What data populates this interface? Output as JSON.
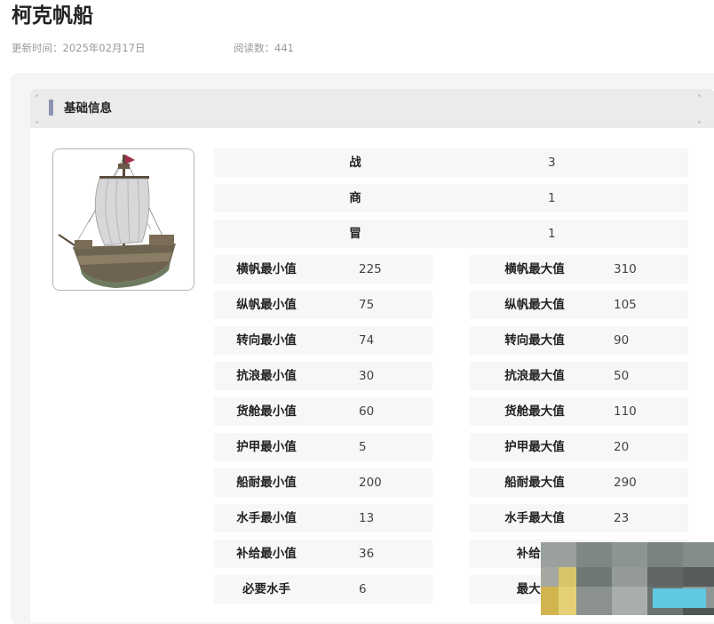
{
  "page": {
    "title": "柯克帆船",
    "update_time": "更新时间：2025年02月17日",
    "read_count": "阅读数：441"
  },
  "section": {
    "header": "基础信息"
  },
  "ship_image": {
    "icon": "sailing-ship-image"
  },
  "full_rows": [
    {
      "label": "战",
      "value": "3"
    },
    {
      "label": "商",
      "value": "1"
    },
    {
      "label": "冒",
      "value": "1"
    }
  ],
  "stat_rows": [
    {
      "left_label": "横帆最小值",
      "left_value": "225",
      "right_label": "横帆最大值",
      "right_value": "310"
    },
    {
      "left_label": "纵帆最小值",
      "left_value": "75",
      "right_label": "纵帆最大值",
      "right_value": "105"
    },
    {
      "left_label": "转向最小值",
      "left_value": "74",
      "right_label": "转向最大值",
      "right_value": "90"
    },
    {
      "left_label": "抗浪最小值",
      "left_value": "30",
      "right_label": "抗浪最大值",
      "right_value": "50"
    },
    {
      "left_label": "货舱最小值",
      "left_value": "60",
      "right_label": "货舱最大值",
      "right_value": "110"
    },
    {
      "left_label": "护甲最小值",
      "left_value": "5",
      "right_label": "护甲最大值",
      "right_value": "20"
    },
    {
      "left_label": "船耐最小值",
      "left_value": "200",
      "right_label": "船耐最大值",
      "right_value": "290"
    },
    {
      "left_label": "水手最小值",
      "left_value": "13",
      "right_label": "水手最大值",
      "right_value": "23"
    },
    {
      "left_label": "补给最小值",
      "left_value": "36",
      "right_label": "补给最",
      "right_value": ""
    },
    {
      "left_label": "必要水手",
      "left_value": "6",
      "right_label": "最大炮",
      "right_value": ""
    }
  ],
  "colors": {
    "accent_bar": "#8d93ad",
    "cell_bg": "#f7f7f8",
    "panel_bg": "#f5f5f6"
  }
}
